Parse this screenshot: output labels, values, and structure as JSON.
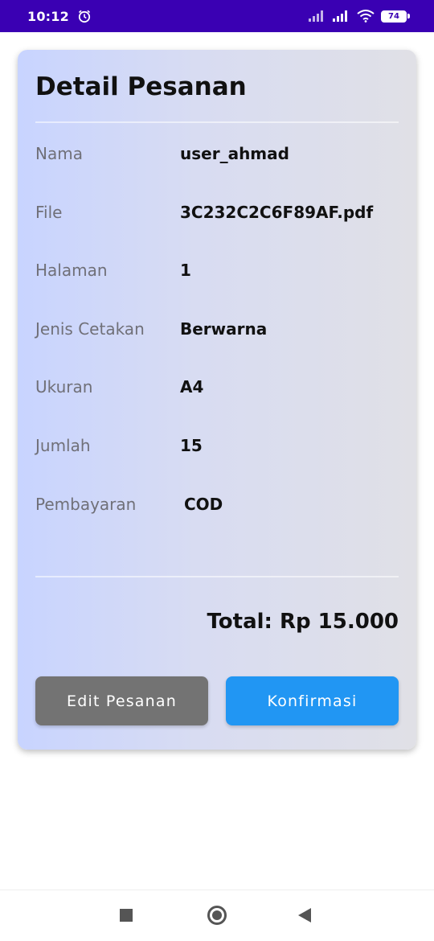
{
  "status_bar": {
    "time": "10:12",
    "battery_level": "74",
    "icons": [
      "alarm-icon",
      "signal-icon",
      "signal-icon",
      "wifi-icon",
      "battery-icon"
    ]
  },
  "order_detail": {
    "title": "Detail Pesanan",
    "rows": [
      {
        "label": "Nama",
        "value": "user_ahmad"
      },
      {
        "label": "File",
        "value": "3C232C2C6F89AF.pdf"
      },
      {
        "label": "Halaman",
        "value": "1"
      },
      {
        "label": "Jenis Cetakan",
        "value": "Berwarna"
      },
      {
        "label": "Ukuran",
        "value": "A4"
      },
      {
        "label": "Jumlah",
        "value": "15"
      },
      {
        "label": "Pembayaran",
        "value": "COD"
      }
    ],
    "total": "Total: Rp 15.000",
    "edit_button": "Edit Pesanan",
    "confirm_button": "Konfirmasi"
  },
  "colors": {
    "status_bar": "#3a00b3",
    "edit_button": "#737373",
    "confirm_button": "#2196f3"
  },
  "nav_bar": {
    "icons": [
      "recents-icon",
      "home-icon",
      "back-icon"
    ]
  }
}
